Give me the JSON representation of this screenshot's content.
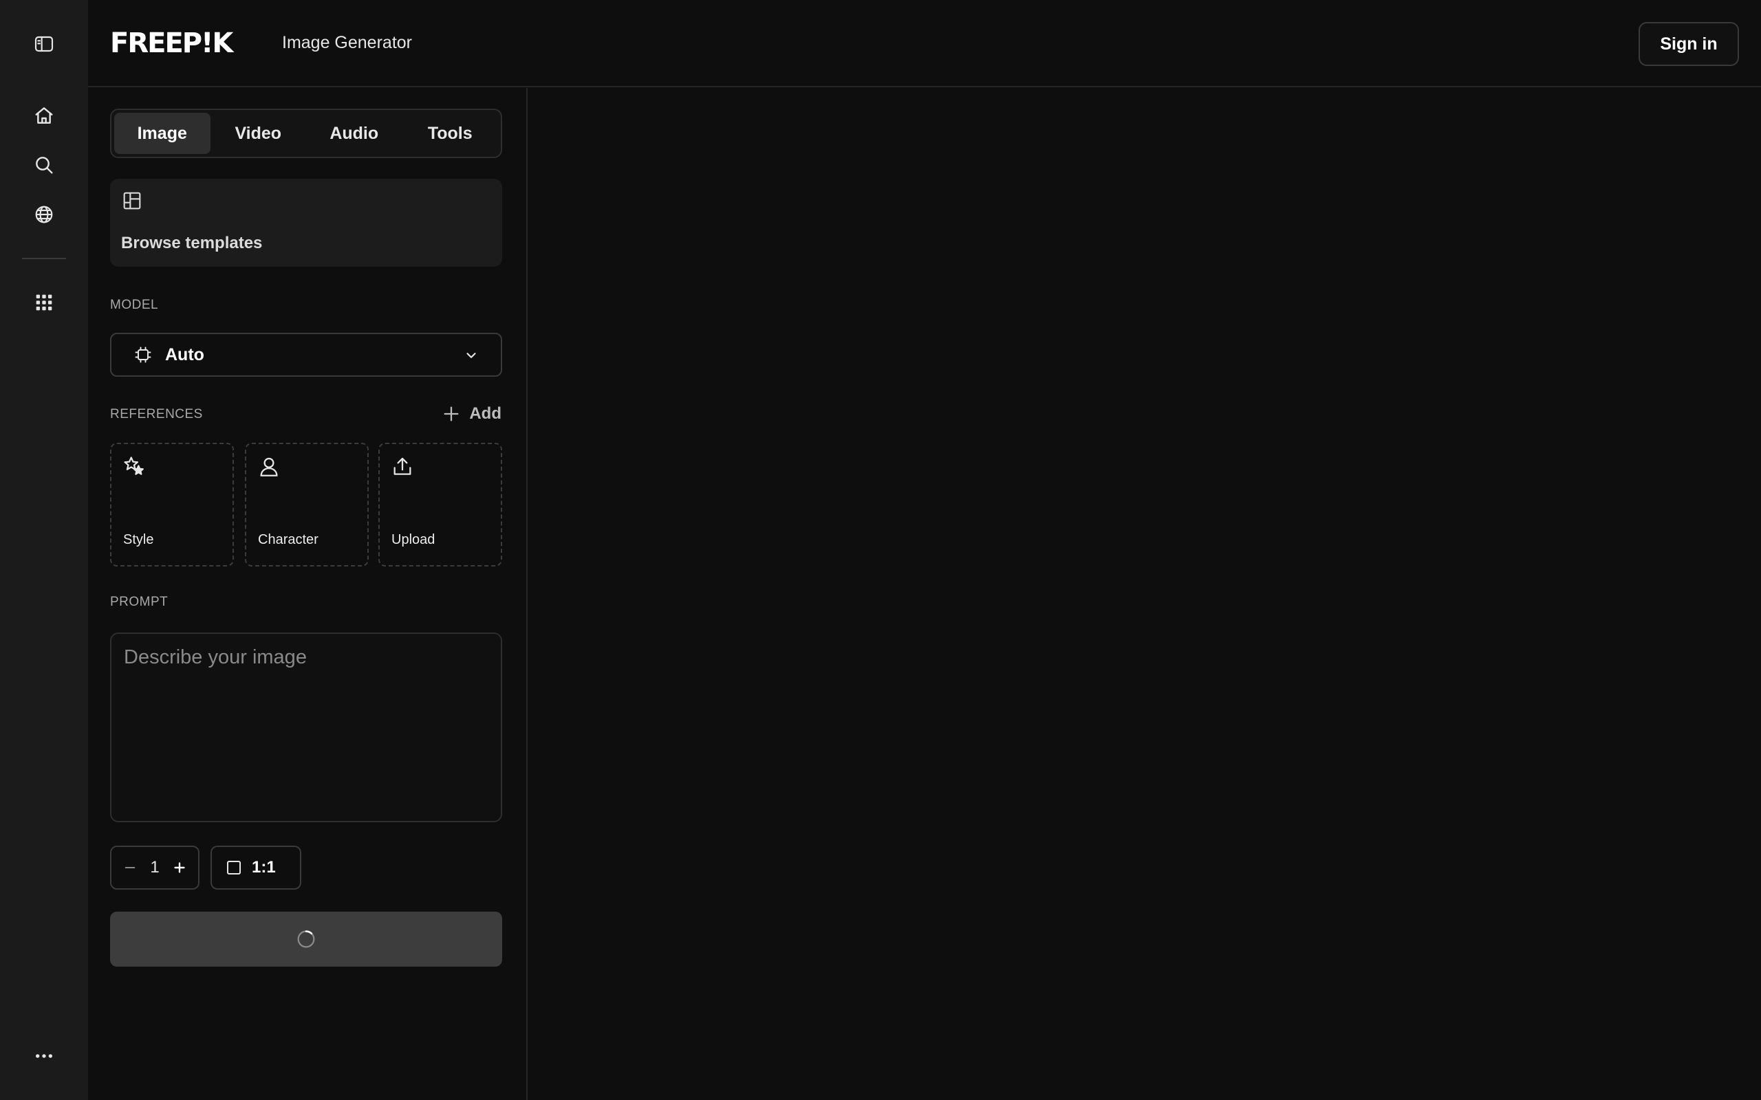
{
  "brand": {
    "logo_text": "FREEP!K",
    "product": "Image Generator"
  },
  "header": {
    "signin_label": "Sign in"
  },
  "rail": {
    "items": [
      {
        "name": "sidebar-toggle-icon"
      },
      {
        "name": "home-icon"
      },
      {
        "name": "search-icon"
      },
      {
        "name": "globe-icon"
      },
      {
        "name": "apps-grid-icon"
      },
      {
        "name": "more-icon"
      }
    ]
  },
  "tabs": [
    {
      "label": "Image",
      "active": true
    },
    {
      "label": "Video",
      "active": false
    },
    {
      "label": "Audio",
      "active": false
    },
    {
      "label": "Tools",
      "active": false
    }
  ],
  "templates": {
    "label": "Browse templates"
  },
  "model": {
    "section_label": "MODEL",
    "value": "Auto"
  },
  "references": {
    "section_label": "REFERENCES",
    "add_label": "Add",
    "cards": [
      {
        "label": "Style",
        "icon": "star-sparkle-icon"
      },
      {
        "label": "Character",
        "icon": "user-icon"
      },
      {
        "label": "Upload",
        "icon": "upload-icon"
      }
    ]
  },
  "prompt": {
    "section_label": "PROMPT",
    "placeholder": "Describe your image",
    "value": ""
  },
  "settings": {
    "count": "1",
    "aspect_ratio": "1:1"
  },
  "colors": {
    "background": "#0e0e0e",
    "rail": "#1b1b1b",
    "button": "#3d3d3d"
  }
}
